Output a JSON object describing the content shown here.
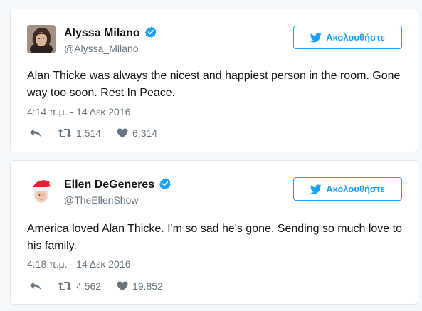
{
  "tweets": [
    {
      "name": "Alyssa Milano",
      "handle": "@Alyssa_Milano",
      "follow_label": "Ακολουθήστε",
      "text": "Alan Thicke was always the nicest and happiest person in the room. Gone way too soon. Rest In Peace.",
      "timestamp": "4:14 π.μ. - 14 Δεκ 2016",
      "retweets": "1.514",
      "likes": "6.314",
      "avatar_icon": "avatar-photo-woman"
    },
    {
      "name": "Ellen DeGeneres",
      "handle": "@TheEllenShow",
      "follow_label": "Ακολουθήστε",
      "text": "America loved Alan Thicke. I'm so sad he's gone. Sending so much love to his family.",
      "timestamp": "4:18 π.μ. - 14 Δεκ 2016",
      "retweets": "4.562",
      "likes": "19.852",
      "avatar_icon": "avatar-santa-hat"
    }
  ],
  "colors": {
    "accent": "#1da1f2",
    "text_primary": "#14171a",
    "text_secondary": "#66757f",
    "border": "#e1e8ed",
    "background": "#f5f8fa"
  }
}
